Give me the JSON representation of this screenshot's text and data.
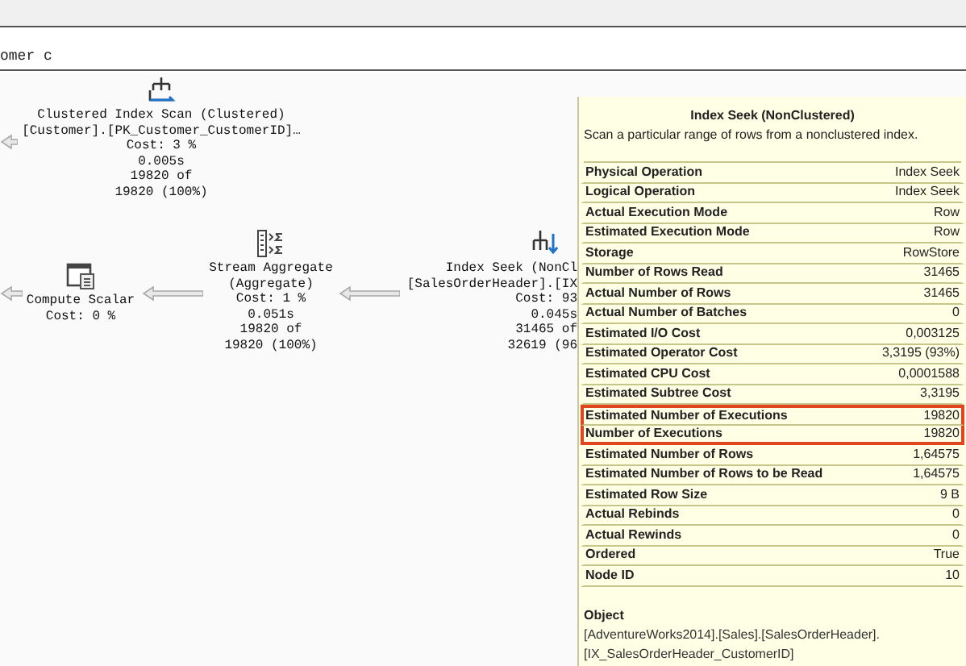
{
  "query_text": "omer c",
  "nodes": [
    {
      "kind": "clustered_index_scan",
      "lines": [
        "Clustered Index Scan (Clustered)",
        "[Customer].[PK_Customer_CustomerID]…",
        "Cost: 3 %",
        "0.005s",
        "19820 of",
        "19820 (100%)"
      ]
    },
    {
      "kind": "compute_scalar",
      "lines": [
        "Compute Scalar",
        "Cost: 0 %"
      ]
    },
    {
      "kind": "stream_aggregate",
      "lines": [
        "Stream Aggregate",
        "(Aggregate)",
        "Cost: 1 %",
        "0.051s",
        "19820 of",
        "19820 (100%)"
      ]
    },
    {
      "kind": "index_seek",
      "lines": [
        "Index Seek (NonCl",
        "[SalesOrderHeader].[IX",
        "Cost: 93",
        "0.045s",
        "31465 of",
        "32619 (96"
      ]
    }
  ],
  "tooltip": {
    "title": "Index Seek (NonClustered)",
    "description": "Scan a particular range of rows from a nonclustered index.",
    "properties": [
      {
        "name": "Physical Operation",
        "value": "Index Seek",
        "highlighted": false
      },
      {
        "name": "Logical Operation",
        "value": "Index Seek",
        "highlighted": false
      },
      {
        "name": "Actual Execution Mode",
        "value": "Row",
        "highlighted": false
      },
      {
        "name": "Estimated Execution Mode",
        "value": "Row",
        "highlighted": false
      },
      {
        "name": "Storage",
        "value": "RowStore",
        "highlighted": false
      },
      {
        "name": "Number of Rows Read",
        "value": "31465",
        "highlighted": false
      },
      {
        "name": "Actual Number of Rows",
        "value": "31465",
        "highlighted": false
      },
      {
        "name": "Actual Number of Batches",
        "value": "0",
        "highlighted": false
      },
      {
        "name": "Estimated I/O Cost",
        "value": "0,003125",
        "highlighted": false
      },
      {
        "name": "Estimated Operator Cost",
        "value": "3,3195 (93%)",
        "highlighted": false
      },
      {
        "name": "Estimated CPU Cost",
        "value": "0,0001588",
        "highlighted": false
      },
      {
        "name": "Estimated Subtree Cost",
        "value": "3,3195",
        "highlighted": false
      },
      {
        "name": "Estimated Number of Executions",
        "value": "19820",
        "highlighted": true
      },
      {
        "name": "Number of Executions",
        "value": "19820",
        "highlighted": true
      },
      {
        "name": "Estimated Number of Rows",
        "value": "1,64575",
        "highlighted": false
      },
      {
        "name": "Estimated Number of Rows to be Read",
        "value": "1,64575",
        "highlighted": false
      },
      {
        "name": "Estimated Row Size",
        "value": "9 B",
        "highlighted": false
      },
      {
        "name": "Actual Rebinds",
        "value": "0",
        "highlighted": false
      },
      {
        "name": "Actual Rewinds",
        "value": "0",
        "highlighted": false
      },
      {
        "name": "Ordered",
        "value": "True",
        "highlighted": false
      },
      {
        "name": "Node ID",
        "value": "10",
        "highlighted": false
      }
    ],
    "object": {
      "label": "Object",
      "lines": [
        "[AdventureWorks2014].[Sales].[SalesOrderHeader].",
        "[IX_SalesOrderHeader_CustomerID]"
      ]
    }
  }
}
